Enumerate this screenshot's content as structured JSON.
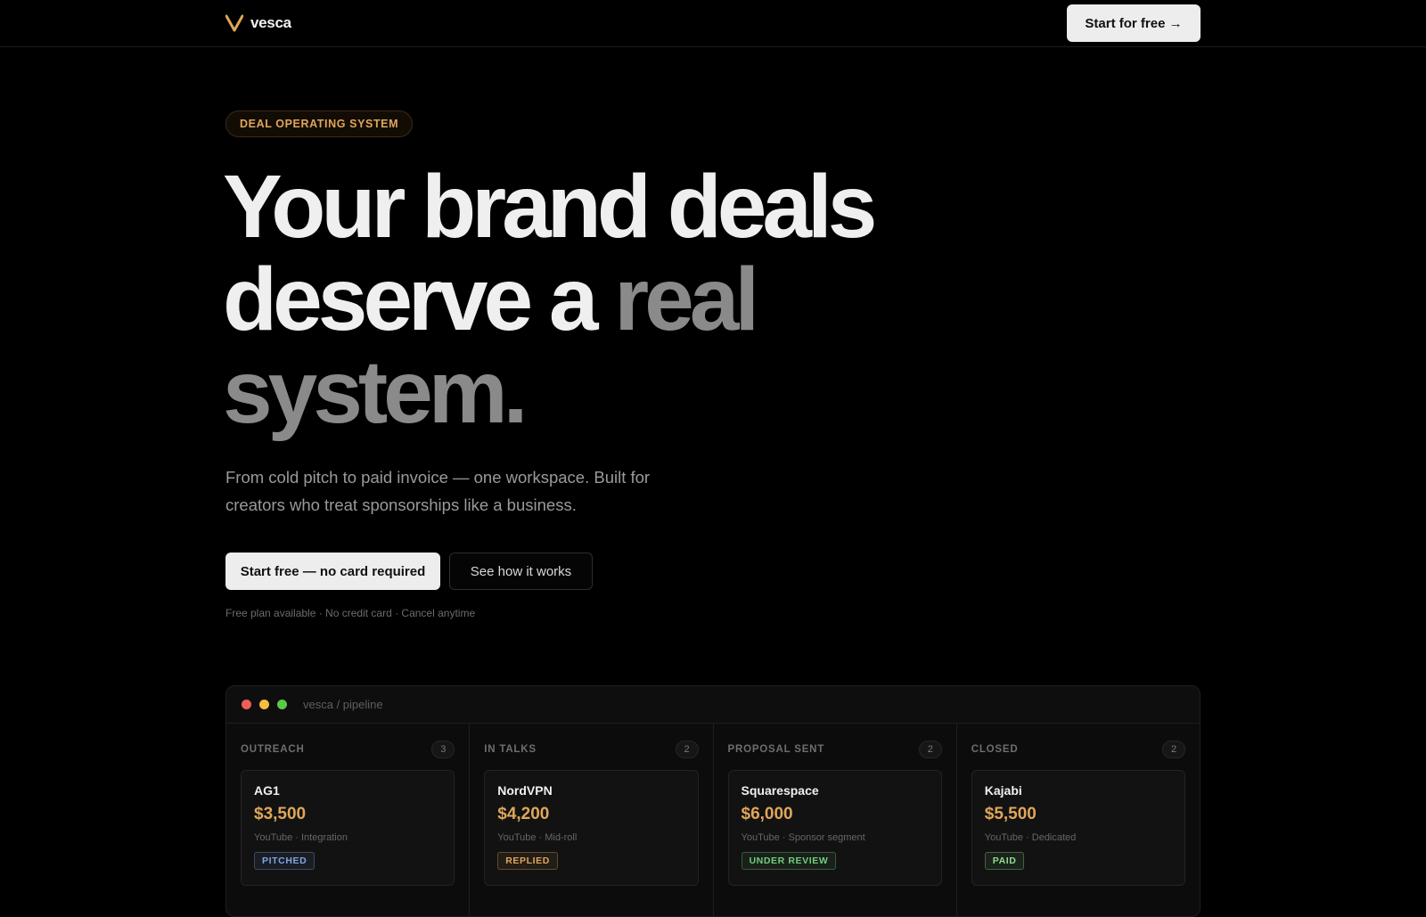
{
  "nav": {
    "brand": "vesca",
    "cta": "Start for free →"
  },
  "hero": {
    "eyebrow": "DEAL OPERATING SYSTEM",
    "headline_line1": "Your brand deals",
    "headline_line2_a": "deserve a ",
    "headline_line2_b": "real",
    "headline_line3": "system.",
    "subhead": "From cold pitch to paid invoice — one workspace. Built for creators who treat sponsorships like a business.",
    "primary_cta": "Start free — no card required",
    "secondary_cta": "See how it works",
    "fineprint": "Free plan available · No credit card · Cancel anytime"
  },
  "preview": {
    "window_title": "vesca / pipeline",
    "columns": [
      {
        "name": "OUTREACH",
        "count": "3",
        "card": {
          "brand": "AG1",
          "amount": "$3,500",
          "meta": "YouTube · Integration",
          "status": "PITCHED"
        }
      },
      {
        "name": "IN TALKS",
        "count": "2",
        "card": {
          "brand": "NordVPN",
          "amount": "$4,200",
          "meta": "YouTube · Mid-roll",
          "status": "REPLIED"
        }
      },
      {
        "name": "PROPOSAL SENT",
        "count": "2",
        "card": {
          "brand": "Squarespace",
          "amount": "$6,000",
          "meta": "YouTube · Sponsor segment",
          "status": "UNDER REVIEW"
        }
      },
      {
        "name": "CLOSED",
        "count": "2",
        "card": {
          "brand": "Kajabi",
          "amount": "$5,500",
          "meta": "YouTube · Dedicated",
          "status": "PAID"
        }
      }
    ]
  },
  "colors": {
    "accent": "#e0a65a",
    "dot_red": "#ee5f57",
    "dot_yellow": "#f5bd3f",
    "dot_green": "#5cc84a",
    "status_pitched": "#7ea6e8",
    "status_replied": "#e0a65a",
    "status_review": "#6fcf7c",
    "status_paid": "#8ee08e"
  }
}
